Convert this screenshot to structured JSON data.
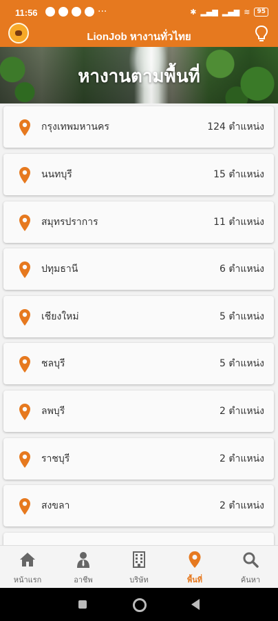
{
  "status": {
    "time": "11:56",
    "more": "···",
    "battery": "95"
  },
  "app": {
    "title": "LionJob หางานทั่วไทย"
  },
  "hero": {
    "heading": "หางานตามพื้นที่"
  },
  "provinces": [
    {
      "name": "กรุงเทพมหานคร",
      "count": "124 ตำแหน่ง"
    },
    {
      "name": "นนทบุรี",
      "count": "15 ตำแหน่ง"
    },
    {
      "name": "สมุทรปราการ",
      "count": "11 ตำแหน่ง"
    },
    {
      "name": "ปทุมธานี",
      "count": "6 ตำแหน่ง"
    },
    {
      "name": "เชียงใหม่",
      "count": "5 ตำแหน่ง"
    },
    {
      "name": "ชลบุรี",
      "count": "5 ตำแหน่ง"
    },
    {
      "name": "ลพบุรี",
      "count": "2 ตำแหน่ง"
    },
    {
      "name": "ราชบุรี",
      "count": "2 ตำแหน่ง"
    },
    {
      "name": "สงขลา",
      "count": "2 ตำแหน่ง"
    }
  ],
  "nav": [
    {
      "label": "หน้าแรก",
      "icon": "home-icon"
    },
    {
      "label": "อาชีพ",
      "icon": "person-icon"
    },
    {
      "label": "บริษัท",
      "icon": "building-icon"
    },
    {
      "label": "พื้นที่",
      "icon": "location-pin-icon",
      "active": true
    },
    {
      "label": "ค้นหา",
      "icon": "search-icon"
    }
  ],
  "colors": {
    "accent": "#e6791f",
    "inactive": "#666666"
  }
}
